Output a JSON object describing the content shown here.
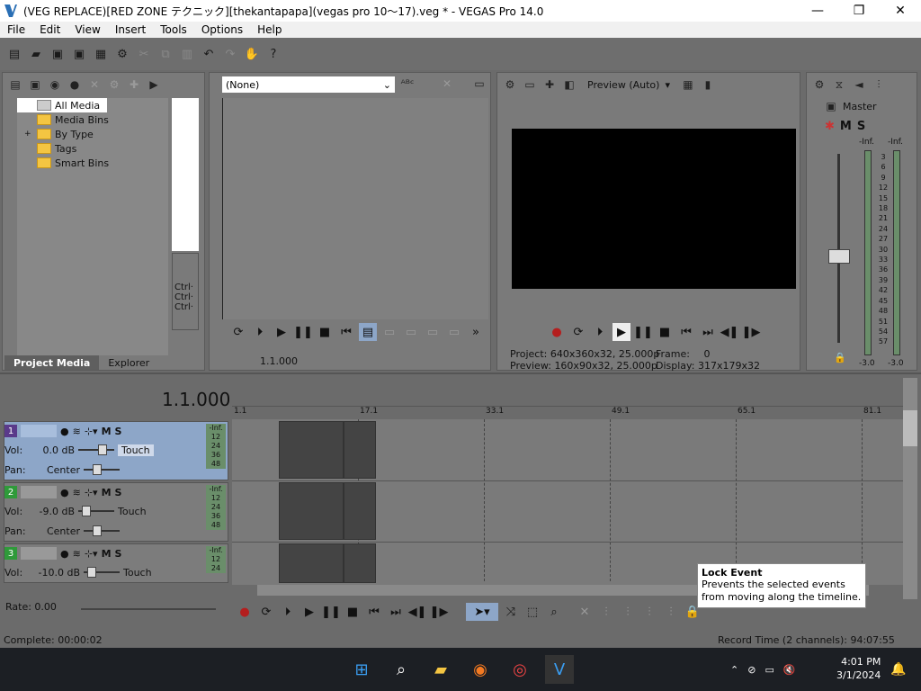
{
  "window": {
    "title": "(VEG REPLACE)[RED ZONE テクニック][thekantapapa](vegas pro 10〜17).veg * - VEGAS Pro 14.0"
  },
  "menu": [
    "File",
    "Edit",
    "View",
    "Insert",
    "Tools",
    "Options",
    "Help"
  ],
  "project_media": {
    "tree": [
      "All Media",
      "Media Bins",
      "By Type",
      "Tags",
      "Smart Bins"
    ],
    "tabs": [
      "Project Media",
      "Explorer"
    ],
    "expand_glyph": "+"
  },
  "trimmer": {
    "dropdown": "(None)",
    "timecode": "1.1.000",
    "ctrl_labels": [
      "Ctrl·",
      "Ctrl·",
      "Ctrl·"
    ]
  },
  "preview": {
    "mode": "Preview (Auto)",
    "project_label": "Project:",
    "project_value": "640x360x32, 25.000p",
    "preview_label": "Preview:",
    "preview_value": "160x90x32, 25.000p",
    "frame_label": "Frame:",
    "frame_value": "0",
    "display_label": "Display:",
    "display_value": "317x179x32"
  },
  "master": {
    "label": "Master",
    "m": "M",
    "s": "S",
    "inf_left": "-Inf.",
    "inf_right": "-Inf.",
    "scale": [
      "3",
      "6",
      "9",
      "12",
      "15",
      "18",
      "21",
      "24",
      "27",
      "30",
      "33",
      "36",
      "39",
      "42",
      "45",
      "48",
      "51",
      "54",
      "57"
    ],
    "bottom_left": "-3.0",
    "bottom_right": "-3.0"
  },
  "timeline": {
    "cursor": "1.1.000",
    "ruler": [
      "1.1",
      "17.1",
      "33.1",
      "49.1",
      "65.1",
      "81.1"
    ],
    "rate_label": "Rate: 0.00",
    "tracks": [
      {
        "num": "1",
        "vol_label": "Vol:",
        "vol": "0.0 dB",
        "pan_label": "Pan:",
        "pan": "Center",
        "mode": "Touch",
        "m": "M",
        "s": "S",
        "inf": "-Inf.",
        "meter": [
          "12",
          "24",
          "36",
          "48"
        ]
      },
      {
        "num": "2",
        "vol_label": "Vol:",
        "vol": "-9.0 dB",
        "pan_label": "Pan:",
        "pan": "Center",
        "mode": "Touch",
        "m": "M",
        "s": "S",
        "inf": "-Inf.",
        "meter": [
          "12",
          "24",
          "36",
          "48"
        ]
      },
      {
        "num": "3",
        "vol_label": "Vol:",
        "vol": "-10.0 dB",
        "mode": "Touch",
        "m": "M",
        "s": "S",
        "inf": "-Inf.",
        "meter": [
          "12",
          "24"
        ]
      }
    ]
  },
  "tooltip": {
    "title": "Lock Event",
    "body": "Prevents the selected events from moving along the timeline."
  },
  "status": {
    "left": "Complete: 00:00:02",
    "right": "Record Time (2 channels): 94:07:55"
  },
  "taskbar": {
    "time": "4:01 PM",
    "date": "3/1/2024"
  },
  "colors": {
    "accent": "#8da6c8",
    "track2": "#2f9a3a",
    "track1": "#5a3a8a"
  }
}
